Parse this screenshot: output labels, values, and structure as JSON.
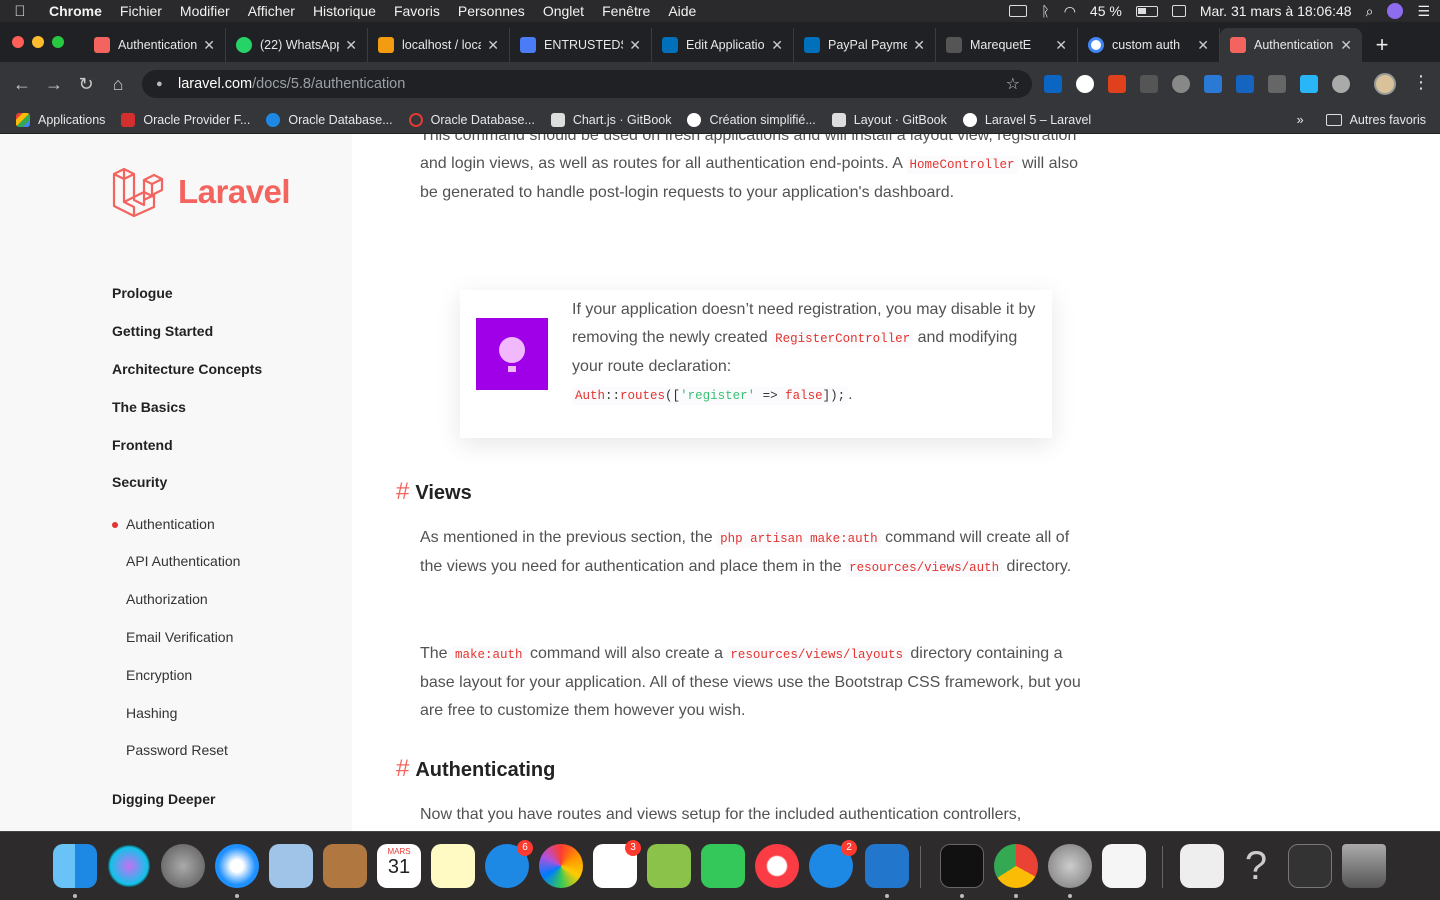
{
  "menubar": {
    "app": "Chrome",
    "items": [
      "Fichier",
      "Modifier",
      "Afficher",
      "Historique",
      "Favoris",
      "Personnes",
      "Onglet",
      "Fenêtre",
      "Aide"
    ],
    "battery": "45 %",
    "datetime": "Mar. 31 mars à 18:06:48"
  },
  "tabs": [
    {
      "title": "Authentication",
      "color": "#f4645f"
    },
    {
      "title": "(22) WhatsApp",
      "color": "#25d366"
    },
    {
      "title": "localhost / localhost",
      "color": "#f39c12"
    },
    {
      "title": "ENTRUSTEDS",
      "color": "#4a7cf7"
    },
    {
      "title": "Edit Application",
      "color": "#0070ba"
    },
    {
      "title": "PayPal Payment",
      "color": "#0070ba"
    },
    {
      "title": "MarequetE",
      "color": "#555555"
    },
    {
      "title": "custom auth",
      "color": "#4285f4"
    },
    {
      "title": "Authentication",
      "color": "#f4645f"
    }
  ],
  "address": {
    "domain": "laravel.com",
    "path": "/docs/5.8/authentication"
  },
  "bookmarks": [
    {
      "label": "Applications",
      "color": "#e94235"
    },
    {
      "label": "Oracle Provider F...",
      "color": "#d32f2f"
    },
    {
      "label": "Oracle Database...",
      "color": "#1e88e5"
    },
    {
      "label": "Oracle Database...",
      "color": "#e53935"
    },
    {
      "label": "Chart.js · GitBook",
      "color": "#dddddd"
    },
    {
      "label": "Création simplifié...",
      "color": "#ffffff"
    },
    {
      "label": "Layout · GitBook",
      "color": "#dddddd"
    },
    {
      "label": "Laravel 5 – Laravel",
      "color": "#ffffff"
    }
  ],
  "bookmarks_more": "»",
  "bookmarks_other": "Autres favoris",
  "logo_text": "Laravel",
  "nav": {
    "sections": [
      "Prologue",
      "Getting Started",
      "Architecture Concepts",
      "The Basics",
      "Frontend",
      "Security"
    ],
    "security_items": [
      "Authentication",
      "API Authentication",
      "Authorization",
      "Email Verification",
      "Encryption",
      "Hashing",
      "Password Reset"
    ],
    "last_section": "Digging Deeper"
  },
  "content": {
    "intro_1": "This command should be used on fresh applications and will install a layout view, registration and login views, as well as routes for all authentication end-points. A",
    "intro_code": "HomeController",
    "intro_2": "will also be generated to handle post-login requests to your application's dashboard.",
    "callout_1": "If your application doesn’t need registration, you may disable it by removing the newly created",
    "callout_code": "RegisterController",
    "callout_2": "and modifying your route declaration:",
    "callout_tail": ".",
    "views_heading": "Views",
    "views_p1_a": "As mentioned in the previous section, the",
    "views_p1_code1": "php artisan make:auth",
    "views_p1_b": "command will create all of the views you need for authentication and place them in the",
    "views_p1_code2": "resources/views/auth",
    "views_p1_c": "directory.",
    "views_p2_a": "The",
    "views_p2_code1": "make:auth",
    "views_p2_b": "command will also create a",
    "views_p2_code2": "resources/views/layouts",
    "views_p2_c": "directory containing a base layout for your application. All of these views use the Bootstrap CSS framework, but you are free to customize them however you wish.",
    "auth_heading": "Authenticating",
    "auth_p": "Now that you have routes and views setup for the included authentication controllers,",
    "hash": "#"
  },
  "dock": {
    "calendar_month": "MARS",
    "calendar_day": "31",
    "messages_badge": "6",
    "reminders_badge": "3",
    "appstore_badge": "2"
  }
}
